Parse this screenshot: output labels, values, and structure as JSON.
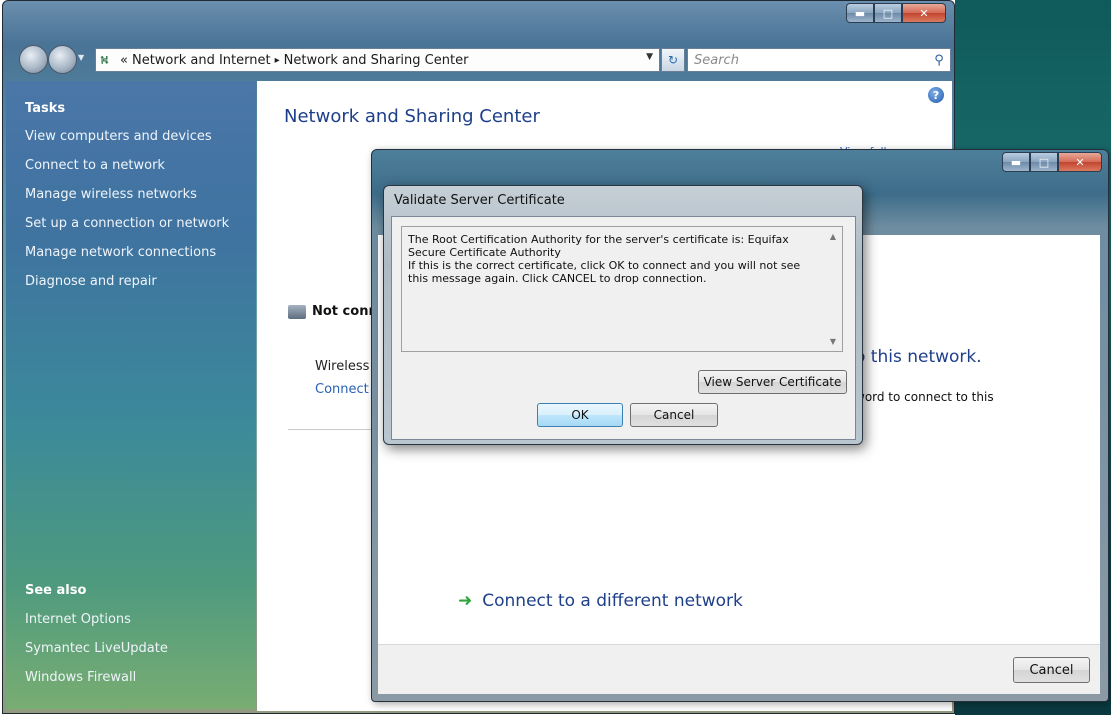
{
  "explorer": {
    "address_parts": [
      "«",
      "Network and Internet",
      "▸",
      "Network and Sharing Center"
    ],
    "search_placeholder": "Search",
    "sidebar": {
      "tasks_header": "Tasks",
      "tasks": [
        "View computers and devices",
        "Connect to a network",
        "Manage wireless networks",
        "Set up a connection or network",
        "Manage network connections",
        "Diagnose and repair"
      ],
      "see_also_header": "See also",
      "see_also": [
        "Internet Options",
        "Symantec LiveUpdate",
        "Windows Firewall"
      ]
    },
    "content": {
      "title": "Network and Sharing Center",
      "view_full_map": "View full map",
      "not_connected": "Not conn",
      "wireless_text": "Wireless r",
      "connect_link": "Connect t"
    }
  },
  "connect_window": {
    "network_heading": "o this network.",
    "password_text": "word to connect to this",
    "diff_network": "Connect to a different network",
    "cancel_label": "Cancel"
  },
  "dialog": {
    "title": "Validate Server Certificate",
    "message": "The Root Certification Authority for the server's certificate is: Equifax Secure Certificate Authority\nIf this is the correct certificate, click OK to connect and you will not see this message again.  Click CANCEL to drop connection.",
    "view_cert_label": "View Server Certificate",
    "ok_label": "OK",
    "cancel_label": "Cancel"
  },
  "icons": {
    "minimize": "minimize-icon",
    "maximize": "maximize-icon",
    "close": "close-icon",
    "help": "help-icon",
    "search": "search-icon",
    "refresh": "refresh-icon"
  }
}
